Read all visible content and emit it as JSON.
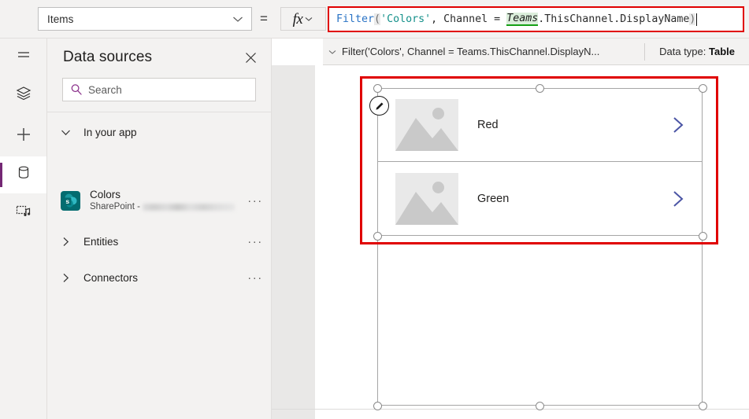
{
  "formula_bar": {
    "property_dropdown": {
      "value": "Items",
      "icon": "chevron-down-icon"
    },
    "equals": "=",
    "fx_button": {
      "label": "fx",
      "icon": "chevron-down-icon"
    },
    "formula_tokens": [
      {
        "text": "Filter",
        "style": "fn"
      },
      {
        "text": "(",
        "style": "paren"
      },
      {
        "text": "'Colors'",
        "style": "str"
      },
      {
        "text": ", Channel = ",
        "style": "plain"
      },
      {
        "text": "Teams",
        "style": "teams"
      },
      {
        "text": ".ThisChannel.DisplayName",
        "style": "plain"
      },
      {
        "text": ")",
        "style": "paren"
      }
    ],
    "formula_plain": "Filter('Colors', Channel = Teams.ThisChannel.DisplayName)"
  },
  "result_bar": {
    "expand_icon": "chevron-down-icon",
    "expression": "Filter('Colors', Channel = Teams.ThisChannel.DisplayN...",
    "data_type_label": "Data type: ",
    "data_type_value": "Table"
  },
  "rail": {
    "items": [
      {
        "name": "menu-icon",
        "label": "Menu",
        "active": false
      },
      {
        "name": "tree-view-icon",
        "label": "Tree view",
        "active": false
      },
      {
        "name": "insert-icon",
        "label": "Insert",
        "active": false
      },
      {
        "name": "data-icon",
        "label": "Data",
        "active": true
      },
      {
        "name": "media-icon",
        "label": "Media",
        "active": false
      }
    ],
    "active_accent": "#742774"
  },
  "panel": {
    "title": "Data sources",
    "close_icon": "close-icon",
    "search": {
      "placeholder": "Search",
      "icon": "search-icon",
      "accent": "#8a2f8a"
    },
    "groups": [
      {
        "label": "In your app",
        "icon": "chevron-down-icon",
        "overflow": "···",
        "expanded": true
      },
      {
        "label": "Entities",
        "icon": "chevron-right-icon",
        "overflow": "···",
        "expanded": false
      },
      {
        "label": "Connectors",
        "icon": "chevron-right-icon",
        "overflow": "···",
        "expanded": false
      }
    ],
    "data_source": {
      "name": "Colors",
      "subtitle_prefix": "SharePoint - ",
      "subtitle_redacted": true,
      "icon": "sharepoint-icon",
      "icon_color": "#036c70",
      "overflow": "···"
    }
  },
  "canvas": {
    "selected_control": "gallery",
    "edit_badge_icon": "pencil-icon",
    "chevron_color": "#4b55a5",
    "annotation_color": "#e00000",
    "gallery_items": [
      {
        "label": "Red",
        "image": "image-placeholder-icon",
        "chevron": "chevron-right-icon"
      },
      {
        "label": "Green",
        "image": "image-placeholder-icon",
        "chevron": "chevron-right-icon"
      }
    ]
  }
}
